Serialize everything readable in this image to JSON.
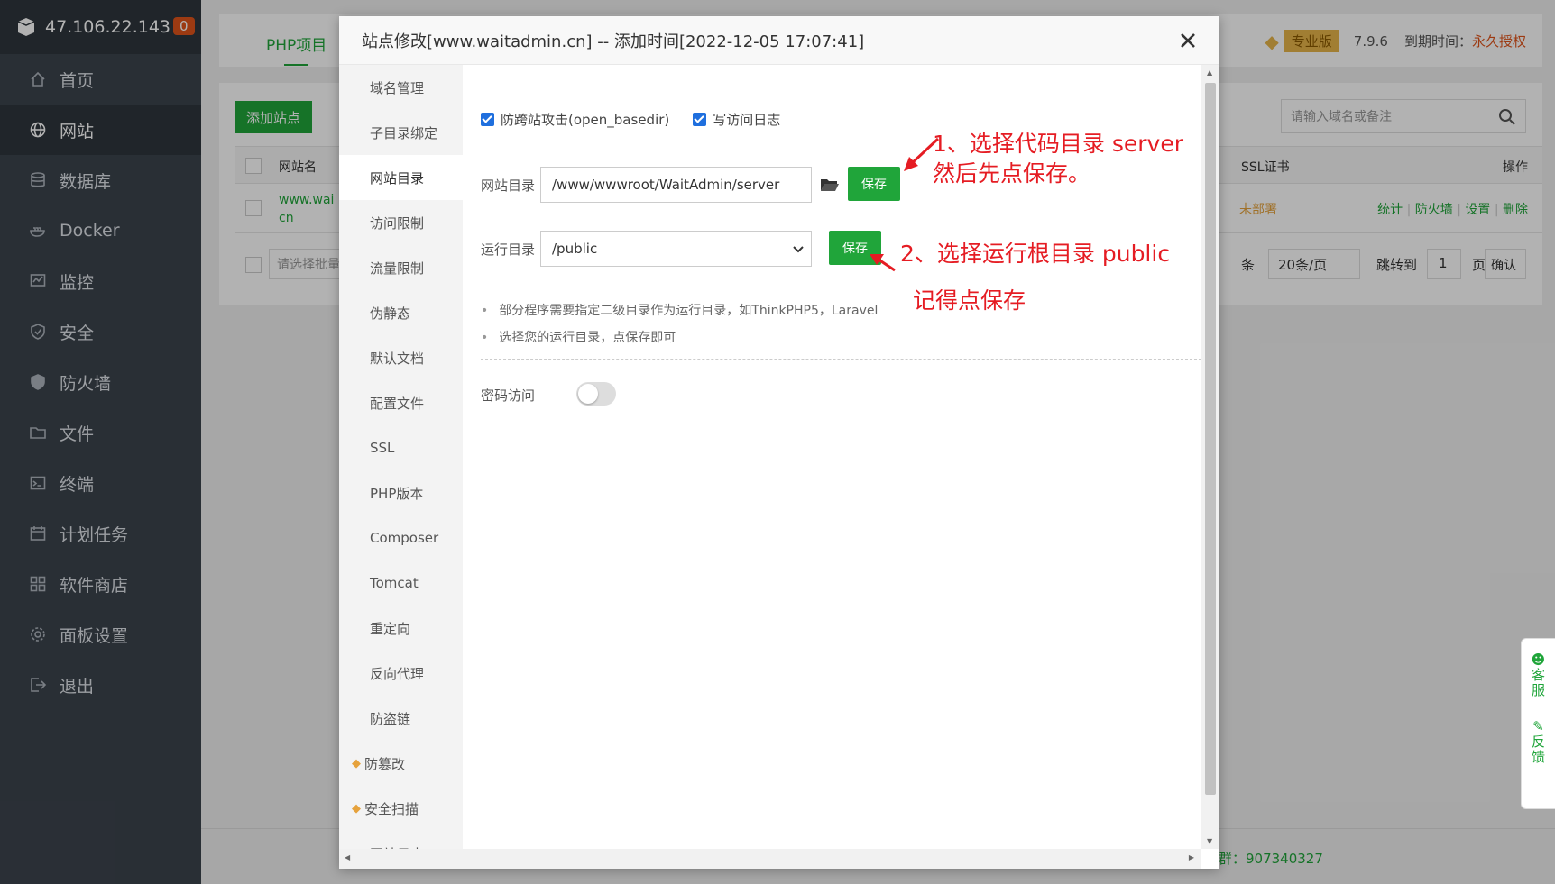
{
  "sidebar": {
    "host": "47.106.22.143",
    "badge": "0",
    "items": [
      {
        "label": "首页",
        "icon": "home-icon"
      },
      {
        "label": "网站",
        "icon": "globe-icon"
      },
      {
        "label": "数据库",
        "icon": "database-icon"
      },
      {
        "label": "Docker",
        "icon": "docker-icon"
      },
      {
        "label": "监控",
        "icon": "monitor-icon"
      },
      {
        "label": "安全",
        "icon": "shield-icon"
      },
      {
        "label": "防火墙",
        "icon": "firewall-icon"
      },
      {
        "label": "文件",
        "icon": "folder-icon"
      },
      {
        "label": "终端",
        "icon": "terminal-icon"
      },
      {
        "label": "计划任务",
        "icon": "calendar-icon"
      },
      {
        "label": "软件商店",
        "icon": "apps-icon"
      },
      {
        "label": "面板设置",
        "icon": "gear-icon"
      },
      {
        "label": "退出",
        "icon": "logout-icon"
      }
    ]
  },
  "topbar": {
    "tab": "PHP项目",
    "edition": "专业版",
    "version": "7.9.6",
    "expire_label": "到期时间：",
    "expire_value": "永久授权"
  },
  "sites": {
    "add_button": "添加站点",
    "search_placeholder": "请输入域名或备注",
    "col_name": "网站名",
    "col_ssl": "SSL证书",
    "col_ops": "操作",
    "row_name_1": "www.wai",
    "row_name_2": "cn",
    "row_ssl": "未部署",
    "ops": [
      "统计",
      "防火墙",
      "设置",
      "删除"
    ],
    "bulk_placeholder": "请选择批量",
    "per_page": "20条/页",
    "page_unit_prefix": "条",
    "jump_label": "跳转到",
    "jump_page": "1",
    "page_label": "页",
    "confirm": "确认"
  },
  "footer": {
    "qq_group": "群：907340327"
  },
  "float": {
    "service": "客服",
    "feedback": "反馈"
  },
  "modal": {
    "title": "站点修改[www.waitadmin.cn] -- 添加时间[2022-12-05 17:07:41]",
    "nav": [
      {
        "label": "域名管理"
      },
      {
        "label": "子目录绑定"
      },
      {
        "label": "网站目录"
      },
      {
        "label": "访问限制"
      },
      {
        "label": "流量限制"
      },
      {
        "label": "伪静态"
      },
      {
        "label": "默认文档"
      },
      {
        "label": "配置文件"
      },
      {
        "label": "SSL"
      },
      {
        "label": "PHP版本"
      },
      {
        "label": "Composer"
      },
      {
        "label": "Tomcat"
      },
      {
        "label": "重定向"
      },
      {
        "label": "反向代理"
      },
      {
        "label": "防盗链"
      },
      {
        "label": "防篡改"
      },
      {
        "label": "安全扫描"
      },
      {
        "label": "网站日志"
      }
    ],
    "checkbox_basedir": "防跨站攻击(open_basedir)",
    "checkbox_log": "写访问日志",
    "site_dir_label": "网站目录",
    "site_dir_value": "/www/wwwroot/WaitAdmin/server",
    "save": "保存",
    "run_dir_label": "运行目录",
    "run_dir_value": "/public",
    "hint_1": "部分程序需要指定二级目录作为运行目录，如ThinkPHP5，Laravel",
    "hint_2": "选择您的运行目录，点保存即可",
    "password_label": "密码访问"
  },
  "annotations": {
    "note_1_line1": "1、选择代码目录 server",
    "note_1_line2": "然后先点保存。",
    "note_2_line1": "2、选择运行根目录 public",
    "note_2_line2": "记得点保存"
  }
}
